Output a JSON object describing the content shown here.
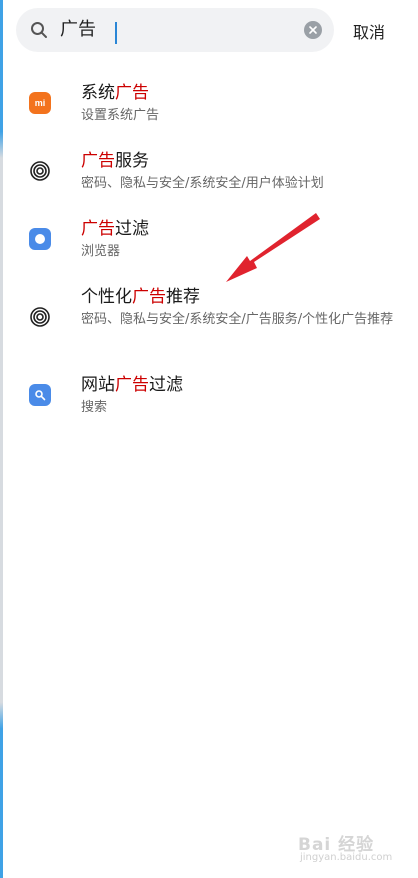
{
  "search": {
    "query": "广告",
    "cancel_label": "取消"
  },
  "results": [
    {
      "icon": "mi-icon",
      "title_pre": "系统",
      "title_hl": "广告",
      "title_post": "",
      "subtitle": "设置系统广告"
    },
    {
      "icon": "fingerprint-icon",
      "title_pre": "",
      "title_hl": "广告",
      "title_post": "服务",
      "subtitle": "密码、隐私与安全/系统安全/用户体验计划"
    },
    {
      "icon": "browser-icon",
      "title_pre": "",
      "title_hl": "广告",
      "title_post": "过滤",
      "subtitle": "浏览器"
    },
    {
      "icon": "fingerprint-icon",
      "title_pre": "个性化",
      "title_hl": "广告",
      "title_post": "推荐",
      "subtitle": "密码、隐私与安全/系统安全/广告服务/个性化广告推荐"
    },
    {
      "icon": "search-app-icon",
      "title_pre": "网站",
      "title_hl": "广告",
      "title_post": "过滤",
      "subtitle": "搜索"
    }
  ],
  "colors": {
    "highlight": "#cc0000",
    "arrow": "#e0232e",
    "mi_orange": "#f3731d",
    "app_blue": "#4a8be8"
  },
  "watermark": {
    "brand": "Bai 经验",
    "url": "jingyan.baidu.com"
  }
}
